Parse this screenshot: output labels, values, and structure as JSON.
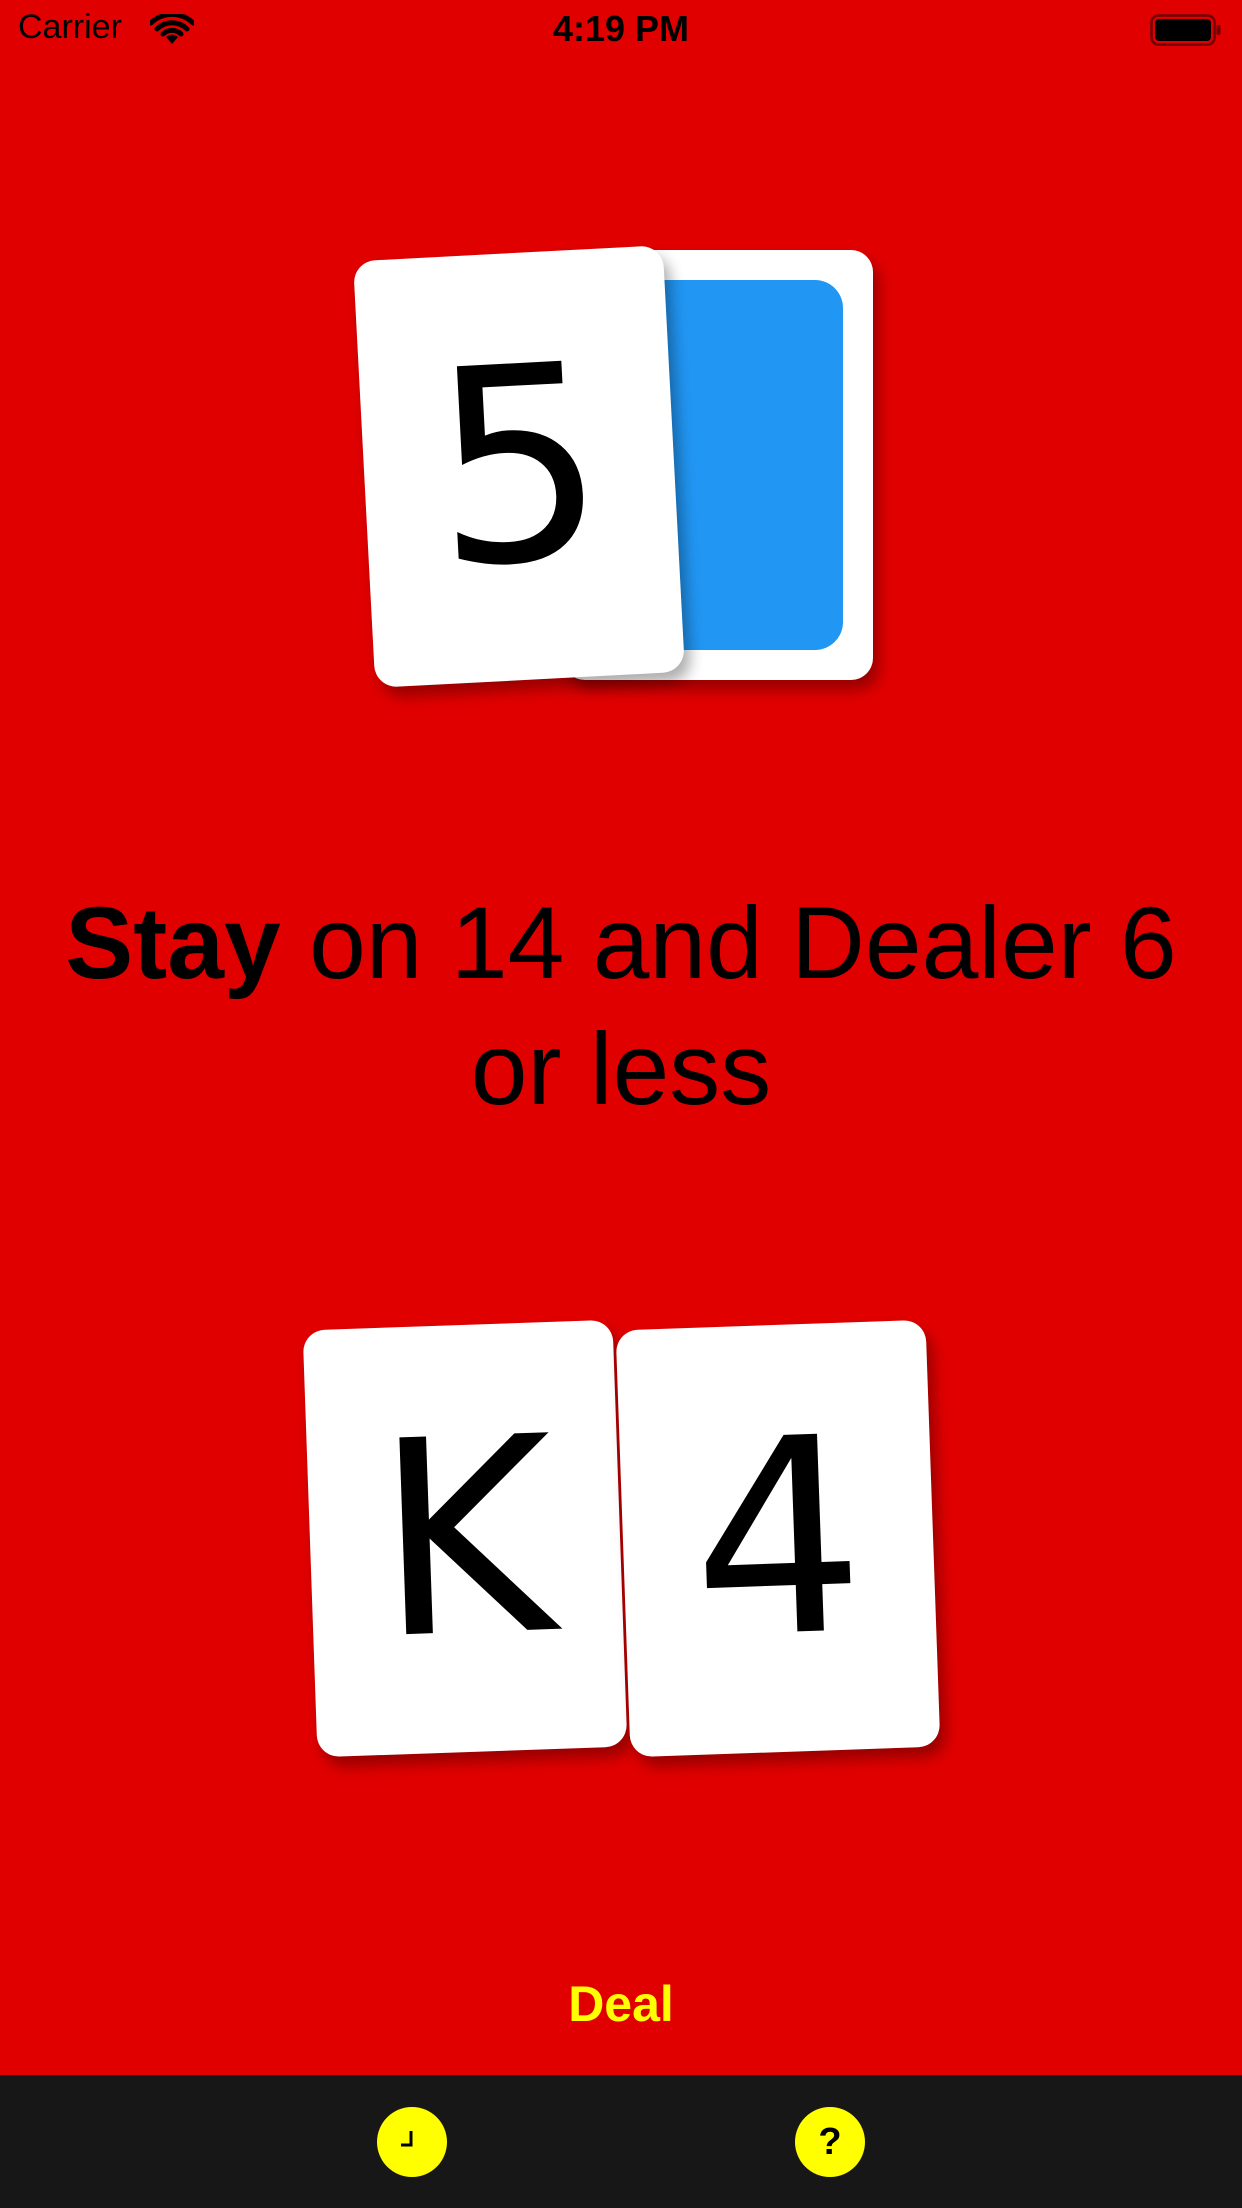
{
  "status_bar": {
    "carrier": "Carrier",
    "time": "4:19 PM"
  },
  "dealer": {
    "up_card": "5",
    "hole_card_color": "#2196f3"
  },
  "advice": {
    "action": "Stay",
    "text": " on 14 and Dealer 6 or less"
  },
  "player": {
    "cards": [
      "K",
      "4"
    ]
  },
  "deal_label": "Deal",
  "tab_bar": {
    "icons": [
      "clock-icon",
      "help-icon"
    ],
    "help_symbol": "?"
  },
  "colors": {
    "background": "#e00000",
    "accent": "#ffff00",
    "tab_bar": "#171717"
  }
}
